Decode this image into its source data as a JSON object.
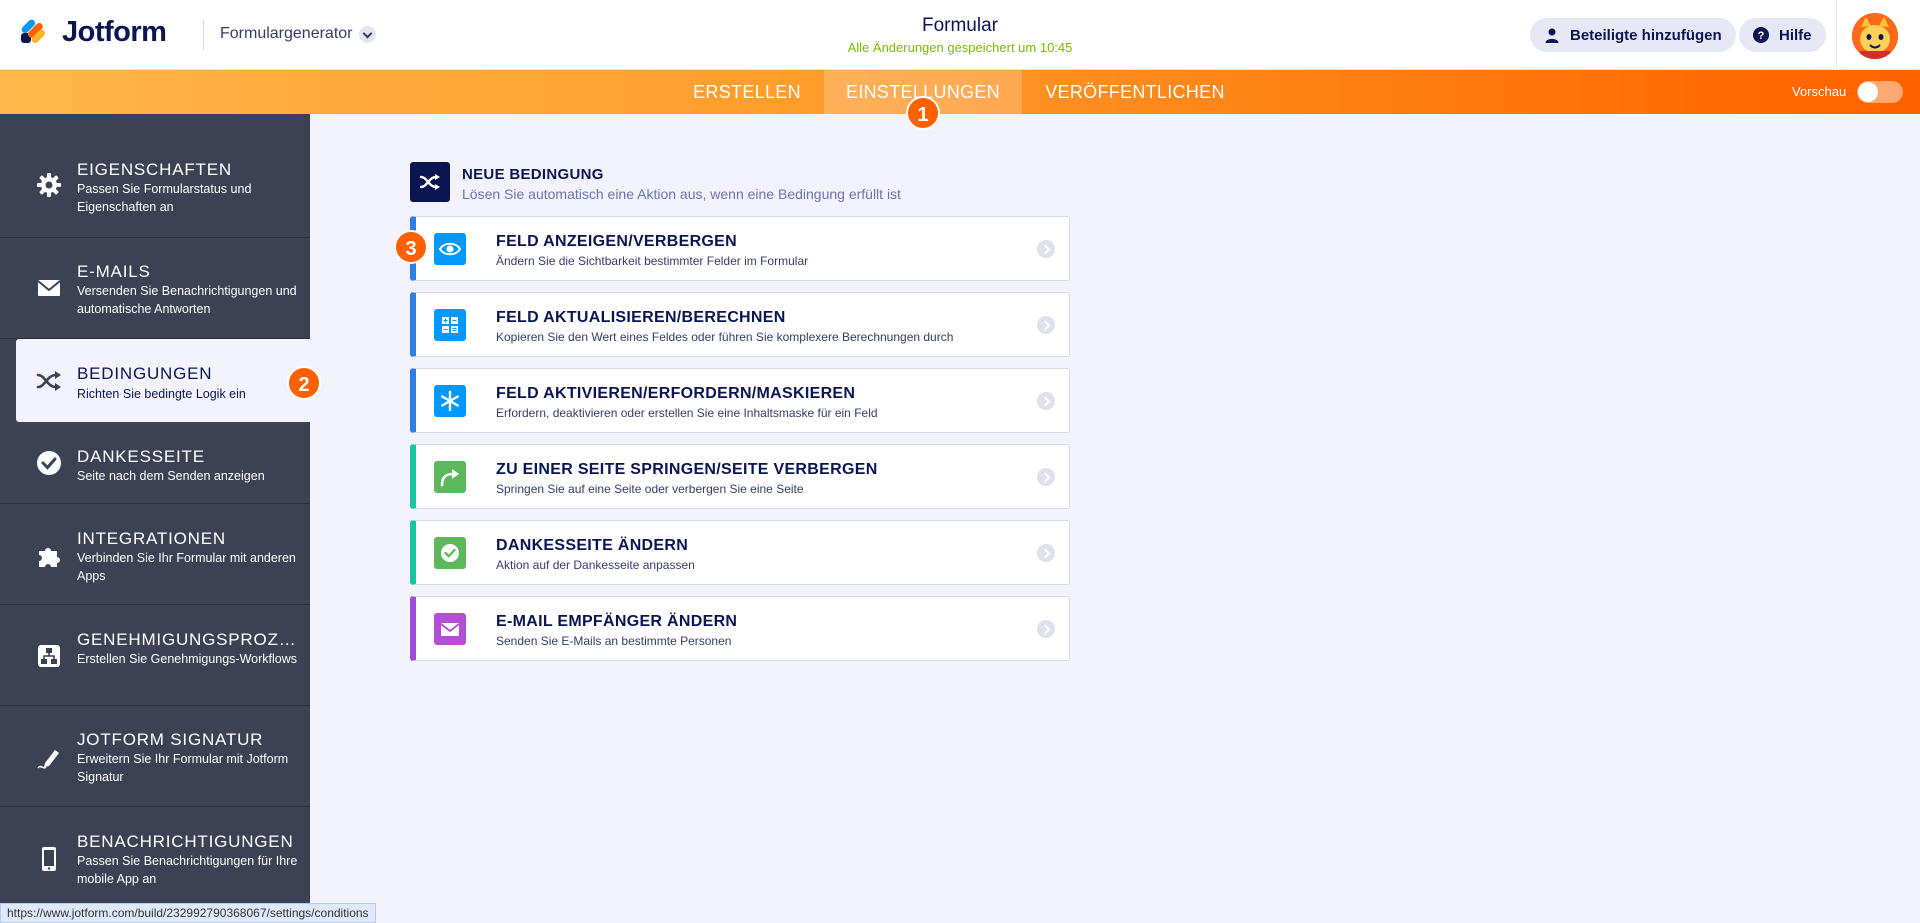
{
  "header": {
    "logo_text": "Jotform",
    "builder_label": "Formulargenerator",
    "form_title": "Formular",
    "save_status": "Alle Änderungen gespeichert um 10:45",
    "invite_label": "Beteiligte hinzufügen",
    "help_label": "Hilfe"
  },
  "nav": {
    "tabs": [
      {
        "label": "ERSTELLEN"
      },
      {
        "label": "EINSTELLUNGEN"
      },
      {
        "label": "VERÖFFENTLICHEN"
      }
    ],
    "preview_label": "Vorschau"
  },
  "steps": [
    "1",
    "2",
    "3"
  ],
  "sidebar": {
    "items": [
      {
        "title": "EIGENSCHAFTEN",
        "desc": "Passen Sie Formularstatus und Eigenschaften an",
        "icon": "gear-icon"
      },
      {
        "title": "E-MAILS",
        "desc": "Versenden Sie Benachrichtigungen und automatische Antworten",
        "icon": "envelope-icon"
      },
      {
        "title": "BEDINGUNGEN",
        "desc": "Richten Sie bedingte Logik ein",
        "icon": "shuffle-icon"
      },
      {
        "title": "DANKESSEITE",
        "desc": "Seite nach dem Senden anzeigen",
        "icon": "check-circle-icon"
      },
      {
        "title": "INTEGRATIONEN",
        "desc": "Verbinden Sie Ihr Formular mit anderen Apps",
        "icon": "puzzle-icon"
      },
      {
        "title": "GENEHMIGUNGSPROZES...",
        "desc": "Erstellen Sie Genehmigungs-Workflows",
        "icon": "workflow-icon"
      },
      {
        "title": "JOTFORM SIGNATUR",
        "desc": "Erweitern Sie Ihr Formular mit Jotform Signatur",
        "icon": "pen-icon"
      },
      {
        "title": "BENACHRICHTIGUNGEN",
        "desc": "Passen Sie Benachrichtigungen für Ihre mobile App an",
        "icon": "mobile-icon"
      }
    ]
  },
  "main": {
    "header_title": "NEUE BEDINGUNG",
    "header_desc": "Lösen Sie automatisch eine Aktion aus, wenn eine Bedingung erfüllt ist",
    "cards": [
      {
        "title": "FELD ANZEIGEN/VERBERGEN",
        "desc": "Ändern Sie die Sichtbarkeit bestimmter Felder im Formular",
        "icon": "eye-icon",
        "color": "#0099ff"
      },
      {
        "title": "FELD AKTUALISIEREN/BERECHNEN",
        "desc": "Kopieren Sie den Wert eines Feldes oder führen Sie komplexere Berechnungen durch",
        "icon": "calculator-icon",
        "color": "#0099ff"
      },
      {
        "title": "FELD AKTIVIEREN/ERFORDERN/MASKIEREN",
        "desc": "Erfordern, deaktivieren oder erstellen Sie eine Inhaltsmaske für ein Feld",
        "icon": "asterisk-icon",
        "color": "#0099ff"
      },
      {
        "title": "ZU EINER SEITE SPRINGEN/SEITE VERBERGEN",
        "desc": "Springen Sie auf eine Seite oder verbergen Sie eine Seite",
        "icon": "redirect-arrow-icon",
        "color": "#5cb85c"
      },
      {
        "title": "DANKESSEITE ÄNDERN",
        "desc": "Aktion auf der Dankesseite anpassen",
        "icon": "check-badge-icon",
        "color": "#5cb85c"
      },
      {
        "title": "E-MAIL EMPFÄNGER ÄNDERN",
        "desc": "Senden Sie E-Mails an bestimmte Personen",
        "icon": "mail-icon",
        "color": "#b34fd6"
      }
    ]
  },
  "statusbar": {
    "url": "https://www.jotform.com/build/232992790368067/settings/conditions"
  }
}
